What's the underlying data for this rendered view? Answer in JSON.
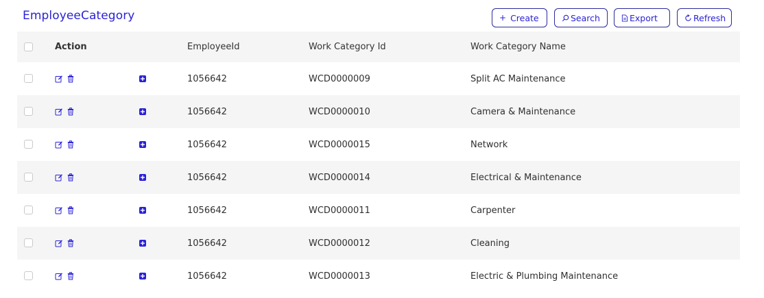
{
  "page_title": "EmployeeCategory",
  "toolbar": {
    "create": {
      "icon": "plus-icon",
      "label": "Create"
    },
    "search": {
      "icon": "search-icon",
      "label": "Search"
    },
    "export": {
      "icon": "document-icon",
      "label": "Export"
    },
    "refresh": {
      "icon": "refresh-icon",
      "label": "Refresh"
    }
  },
  "colors": {
    "accent": "#2a22d6",
    "row_alt": "#f5f5f5",
    "border": "#2a2a9a"
  },
  "table": {
    "columns": {
      "action": "Action",
      "employee_id": "EmployeeId",
      "work_category_id": "Work Category Id",
      "work_category_name": "Work Category Name"
    },
    "rows": [
      {
        "employee_id": "1056642",
        "work_category_id": "WCD0000009",
        "work_category_name": "Split AC Maintenance"
      },
      {
        "employee_id": "1056642",
        "work_category_id": "WCD0000010",
        "work_category_name": "Camera & Maintenance"
      },
      {
        "employee_id": "1056642",
        "work_category_id": "WCD0000015",
        "work_category_name": "Network"
      },
      {
        "employee_id": "1056642",
        "work_category_id": "WCD0000014",
        "work_category_name": "Electrical & Maintenance"
      },
      {
        "employee_id": "1056642",
        "work_category_id": "WCD0000011",
        "work_category_name": "Carpenter"
      },
      {
        "employee_id": "1056642",
        "work_category_id": "WCD0000012",
        "work_category_name": "Cleaning"
      },
      {
        "employee_id": "1056642",
        "work_category_id": "WCD0000013",
        "work_category_name": "Electric & Plumbing Maintenance"
      }
    ]
  }
}
